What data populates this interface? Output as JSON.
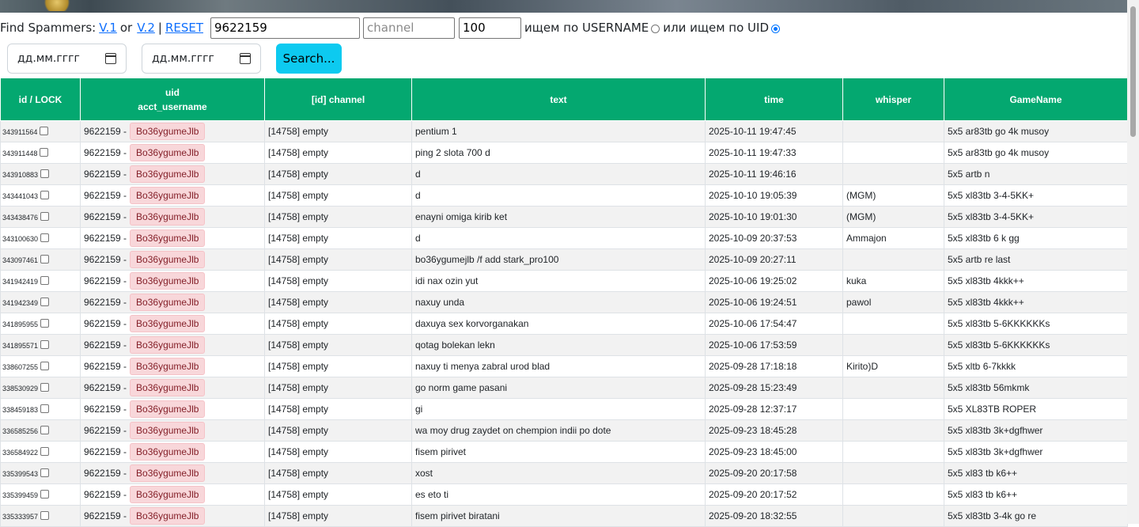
{
  "toolbar": {
    "find_label": "Find Spammers:",
    "v1_link": "V.1",
    "or_label": "or",
    "v2_link": "V.2",
    "pipe": "|",
    "reset_link": "RESET",
    "uid_value": "9622159",
    "channel_placeholder": "channel",
    "limit_value": "100",
    "search_username_label": "ищем по USERNAME",
    "or_search_uid_label": "или ищем по UID",
    "search_mode": "uid"
  },
  "filters": {
    "date_from_placeholder": "дд.мм.гггг",
    "date_to_placeholder": "дд.мм.гггг",
    "search_button": "Search..."
  },
  "table": {
    "headers": {
      "id": "id / LOCK",
      "uid_line1": "uid",
      "uid_line2": "acct_username",
      "channel": "[id] channel",
      "text": "text",
      "time": "time",
      "whisper": "whisper",
      "gamename": "GameName"
    },
    "rows": [
      {
        "id": "343911564",
        "uid": "9622159 -",
        "username": "Bo36ygumeJlb",
        "channel": "[14758] empty",
        "text": "pentium 1",
        "time": "2025-10-11 19:47:45",
        "whisper": "",
        "gamename": "5x5 ar83tb go 4k musoy"
      },
      {
        "id": "343911448",
        "uid": "9622159 -",
        "username": "Bo36ygumeJlb",
        "channel": "[14758] empty",
        "text": "ping 2 slota 700 d",
        "time": "2025-10-11 19:47:33",
        "whisper": "",
        "gamename": "5x5 ar83tb go 4k musoy"
      },
      {
        "id": "343910883",
        "uid": "9622159 -",
        "username": "Bo36ygumeJlb",
        "channel": "[14758] empty",
        "text": "d",
        "time": "2025-10-11 19:46:16",
        "whisper": "",
        "gamename": "5x5 artb n"
      },
      {
        "id": "343441043",
        "uid": "9622159 -",
        "username": "Bo36ygumeJlb",
        "channel": "[14758] empty",
        "text": "d",
        "time": "2025-10-10 19:05:39",
        "whisper": "(MGM)",
        "gamename": "5x5 xl83tb 3-4-5KK+"
      },
      {
        "id": "343438476",
        "uid": "9622159 -",
        "username": "Bo36ygumeJlb",
        "channel": "[14758] empty",
        "text": "enayni omiga kirib ket",
        "time": "2025-10-10 19:01:30",
        "whisper": "(MGM)",
        "gamename": "5x5 xl83tb 3-4-5KK+"
      },
      {
        "id": "343100630",
        "uid": "9622159 -",
        "username": "Bo36ygumeJlb",
        "channel": "[14758] empty",
        "text": "d",
        "time": "2025-10-09 20:37:53",
        "whisper": "Ammajon",
        "gamename": "5x5 xl83tb 6 k gg"
      },
      {
        "id": "343097461",
        "uid": "9622159 -",
        "username": "Bo36ygumeJlb",
        "channel": "[14758] empty",
        "text": "bo36ygumejlb /f add stark_pro100",
        "time": "2025-10-09 20:27:11",
        "whisper": "",
        "gamename": "5x5 artb re last"
      },
      {
        "id": "341942419",
        "uid": "9622159 -",
        "username": "Bo36ygumeJlb",
        "channel": "[14758] empty",
        "text": "idi nax ozin yut",
        "time": "2025-10-06 19:25:02",
        "whisper": "kuka",
        "gamename": "5x5 xl83tb 4kkk++"
      },
      {
        "id": "341942349",
        "uid": "9622159 -",
        "username": "Bo36ygumeJlb",
        "channel": "[14758] empty",
        "text": "naxuy unda",
        "time": "2025-10-06 19:24:51",
        "whisper": "pawol",
        "gamename": "5x5 xl83tb 4kkk++"
      },
      {
        "id": "341895955",
        "uid": "9622159 -",
        "username": "Bo36ygumeJlb",
        "channel": "[14758] empty",
        "text": "daxuya sex korvorganakan",
        "time": "2025-10-06 17:54:47",
        "whisper": "",
        "gamename": "5x5 xl83tb 5-6KKKKKKs"
      },
      {
        "id": "341895571",
        "uid": "9622159 -",
        "username": "Bo36ygumeJlb",
        "channel": "[14758] empty",
        "text": "qotag bolekan lekn",
        "time": "2025-10-06 17:53:59",
        "whisper": "",
        "gamename": "5x5 xl83tb 5-6KKKKKKs"
      },
      {
        "id": "338607255",
        "uid": "9622159 -",
        "username": "Bo36ygumeJlb",
        "channel": "[14758] empty",
        "text": "naxuy ti menya zabral urod blad",
        "time": "2025-09-28 17:18:18",
        "whisper": "Kirito)D",
        "gamename": "5x5 xltb 6-7kkkk"
      },
      {
        "id": "338530929",
        "uid": "9622159 -",
        "username": "Bo36ygumeJlb",
        "channel": "[14758] empty",
        "text": "go norm game pasani",
        "time": "2025-09-28 15:23:49",
        "whisper": "",
        "gamename": "5x5 xl83tb 56mkmk"
      },
      {
        "id": "338459183",
        "uid": "9622159 -",
        "username": "Bo36ygumeJlb",
        "channel": "[14758] empty",
        "text": "gi",
        "time": "2025-09-28 12:37:17",
        "whisper": "",
        "gamename": "5x5 XL83TB ROPER"
      },
      {
        "id": "336585256",
        "uid": "9622159 -",
        "username": "Bo36ygumeJlb",
        "channel": "[14758] empty",
        "text": "wa moy drug zaydet on chempion indii po dote",
        "time": "2025-09-23 18:45:28",
        "whisper": "",
        "gamename": "5x5 xl83tb 3k+dgfhwer"
      },
      {
        "id": "336584922",
        "uid": "9622159 -",
        "username": "Bo36ygumeJlb",
        "channel": "[14758] empty",
        "text": "fisem pirivet",
        "time": "2025-09-23 18:45:00",
        "whisper": "",
        "gamename": "5x5 xl83tb 3k+dgfhwer"
      },
      {
        "id": "335399543",
        "uid": "9622159 -",
        "username": "Bo36ygumeJlb",
        "channel": "[14758] empty",
        "text": "xost",
        "time": "2025-09-20 20:17:58",
        "whisper": "",
        "gamename": "5x5 xl83 tb k6++"
      },
      {
        "id": "335399459",
        "uid": "9622159 -",
        "username": "Bo36ygumeJlb",
        "channel": "[14758] empty",
        "text": "es eto ti",
        "time": "2025-09-20 20:17:52",
        "whisper": "",
        "gamename": "5x5 xl83 tb k6++"
      },
      {
        "id": "335333957",
        "uid": "9622159 -",
        "username": "Bo36ygumeJlb",
        "channel": "[14758] empty",
        "text": "fisem pirivet biratani",
        "time": "2025-09-20 18:32:55",
        "whisper": "",
        "gamename": "5x5 xl83tb 3-4k go re"
      }
    ]
  },
  "colors": {
    "header_bg": "#04a870",
    "search_button": "#0dcaf0",
    "username_badge_bg": "#f8d7da",
    "link": "#0d6efd"
  }
}
